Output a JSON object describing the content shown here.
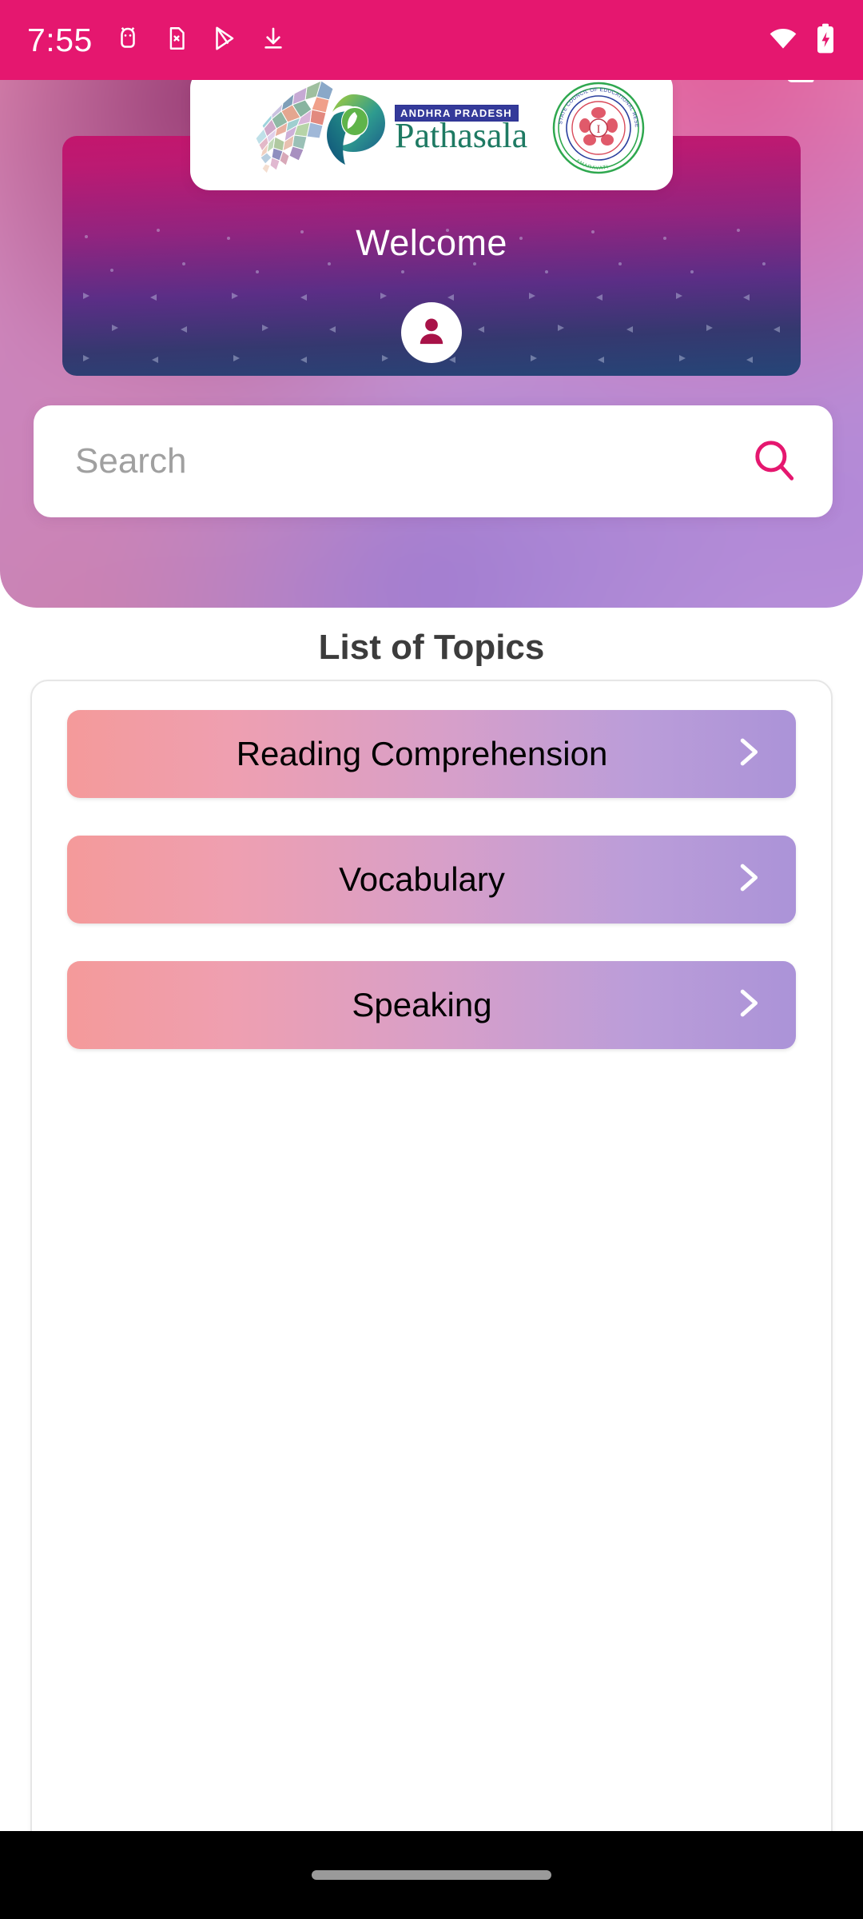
{
  "status_bar": {
    "time": "7:55",
    "background_color": "#e5176f",
    "left_icons": [
      "android-robot-icon",
      "sim-card-error-icon",
      "play-store-icon",
      "download-arrow-icon"
    ],
    "right_icons": [
      "wifi-icon",
      "battery-charging-icon"
    ]
  },
  "header": {
    "logout_icon": "logout-icon",
    "logo": {
      "state_badge": "ANDHRA PRADESH",
      "brand": "Pathasala",
      "map_icon": "andhra-pradesh-map-icon",
      "emblem": "scert-seal-icon",
      "emblem_text": "STATE COUNCIL OF EDUCATIONAL RESEARCH & TRAINING",
      "emblem_place": "AMARAVATI"
    },
    "banner": {
      "welcome_text": "Welcome",
      "avatar_icon": "user-avatar-icon",
      "gradient_top": "#c3166d",
      "gradient_bottom": "#254577"
    },
    "search": {
      "placeholder": "Search",
      "value": "",
      "icon": "search-icon",
      "icon_color": "#e5176f"
    }
  },
  "main": {
    "list_title": "List of Topics",
    "topics": [
      {
        "label": "Reading Comprehension",
        "chevron": "chevron-right-icon"
      },
      {
        "label": "Vocabulary",
        "chevron": "chevron-right-icon"
      },
      {
        "label": "Speaking",
        "chevron": "chevron-right-icon"
      }
    ],
    "topic_gradient_start": "#f49a9a",
    "topic_gradient_end": "#ab93d8"
  },
  "nav_bar": {
    "gesture_pill": "home-gesture-pill"
  }
}
